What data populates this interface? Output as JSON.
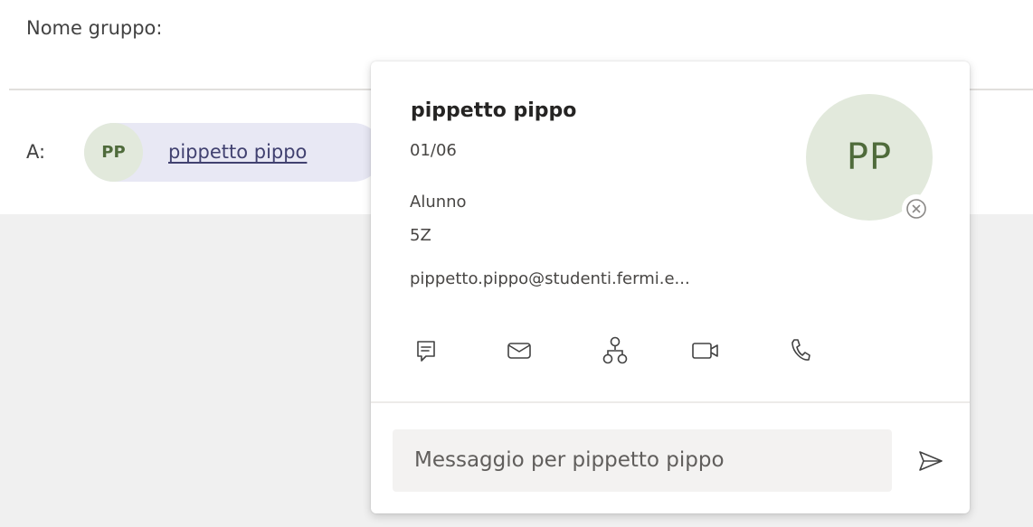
{
  "header": {
    "group_label": "Nome gruppo:"
  },
  "recipients": {
    "to_label": "A:",
    "chip": {
      "initials": "PP",
      "name": "pippetto pippo"
    }
  },
  "card": {
    "name": "pippetto pippo",
    "date": "01/06",
    "role": "Alunno",
    "class": "5Z",
    "email": "pippetto.pippo@studenti.fermi.e...",
    "initials": "PP",
    "presence": "offline",
    "actions": [
      {
        "icon": "chat-icon"
      },
      {
        "icon": "mail-icon"
      },
      {
        "icon": "org-chart-icon"
      },
      {
        "icon": "video-call-icon"
      },
      {
        "icon": "phone-icon"
      }
    ],
    "message_placeholder": "Messaggio per pippetto pippo",
    "send_icon": "send-icon"
  },
  "colors": {
    "avatar_bg": "#e2e9dc",
    "avatar_text": "#4f6b3b",
    "chip_bg": "#e8e8f4",
    "chip_text": "#414170"
  }
}
